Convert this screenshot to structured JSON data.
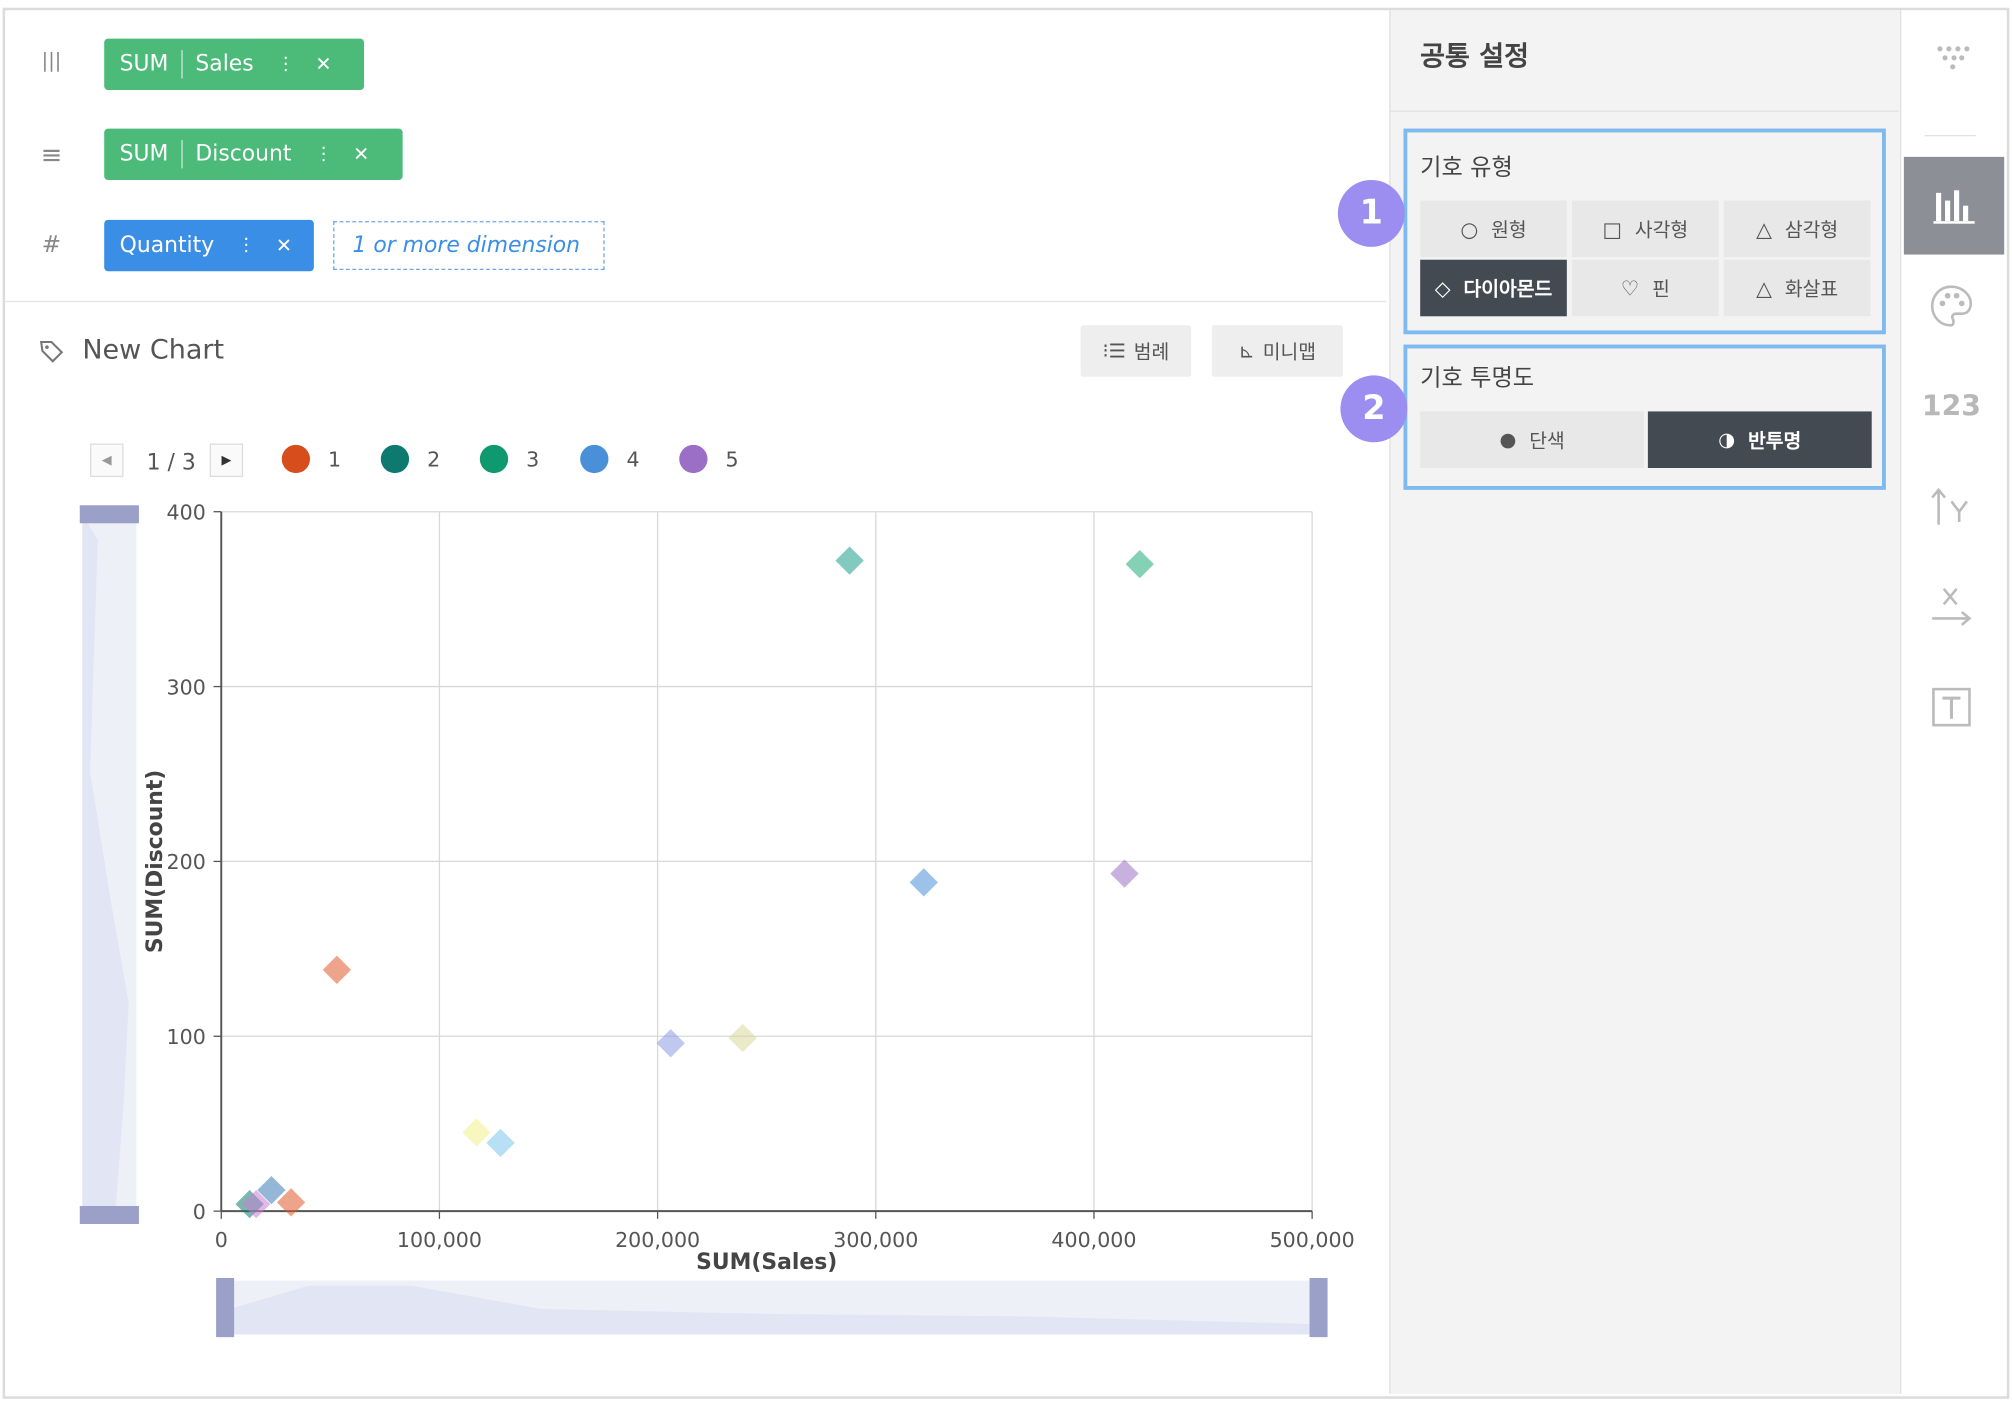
{
  "shelves": {
    "columns": {
      "agg": "SUM",
      "field": "Sales"
    },
    "rows": {
      "agg": "SUM",
      "field": "Discount"
    },
    "measure": {
      "field": "Quantity"
    },
    "placeholder": "1 or more dimension"
  },
  "chart_header": {
    "title": "New Chart",
    "legend_button": "범례",
    "minimap_button": "미니맵"
  },
  "legend": {
    "page": "1 / 3",
    "items": [
      {
        "label": "1",
        "color": "#d84d1c"
      },
      {
        "label": "2",
        "color": "#0e7a6f"
      },
      {
        "label": "3",
        "color": "#0e9a6e"
      },
      {
        "label": "4",
        "color": "#4a90d9"
      },
      {
        "label": "5",
        "color": "#9b6fc5"
      }
    ]
  },
  "chart_data": {
    "type": "scatter",
    "marker": "diamond",
    "xlabel": "SUM(Sales)",
    "ylabel": "SUM(Discount)",
    "xlim": [
      0,
      500000
    ],
    "ylim": [
      0,
      400
    ],
    "xticks": [
      "0",
      "100,000",
      "200,000",
      "300,000",
      "400,000",
      "500,000"
    ],
    "yticks": [
      "0",
      "100",
      "200",
      "300",
      "400"
    ],
    "grid": true,
    "points": [
      {
        "x": 288000,
        "y": 372,
        "color": "#1b9e8a"
      },
      {
        "x": 421000,
        "y": 370,
        "color": "#1fab7a"
      },
      {
        "x": 322000,
        "y": 188,
        "color": "#4a90d9"
      },
      {
        "x": 414000,
        "y": 193,
        "color": "#9b6fc5"
      },
      {
        "x": 53000,
        "y": 138,
        "color": "#e05a2a"
      },
      {
        "x": 206000,
        "y": 96,
        "color": "#8a9be0"
      },
      {
        "x": 239000,
        "y": 99,
        "color": "#d8d79a"
      },
      {
        "x": 117000,
        "y": 45,
        "color": "#f2f08a"
      },
      {
        "x": 128000,
        "y": 39,
        "color": "#7cc7ef"
      },
      {
        "x": 23000,
        "y": 12,
        "color": "#3d7bb8"
      },
      {
        "x": 13000,
        "y": 4,
        "color": "#0e7a6f"
      },
      {
        "x": 16000,
        "y": 4,
        "color": "#c97fd1"
      },
      {
        "x": 32000,
        "y": 5,
        "color": "#e05a2a"
      }
    ]
  },
  "panel": {
    "title": "공통 설정",
    "symbol_type": {
      "label": "기호 유형",
      "options": [
        {
          "label": "원형",
          "icon": "circle-outline-icon"
        },
        {
          "label": "사각형",
          "icon": "square-outline-icon"
        },
        {
          "label": "삼각형",
          "icon": "triangle-outline-icon"
        },
        {
          "label": "다이아몬드",
          "icon": "diamond-outline-icon",
          "selected": true
        },
        {
          "label": "핀",
          "icon": "pin-outline-icon"
        },
        {
          "label": "화살표",
          "icon": "arrow-outline-icon"
        }
      ]
    },
    "symbol_opacity": {
      "label": "기호 투명도",
      "options": [
        {
          "label": "단색",
          "icon": "drop-icon"
        },
        {
          "label": "반투명",
          "icon": "half-circle-icon",
          "selected": true
        }
      ]
    },
    "badges": [
      "1",
      "2"
    ]
  },
  "rail": {
    "items": [
      "chart-type-icon",
      "bar-chart-icon",
      "palette-icon",
      "number-format-icon",
      "y-axis-icon",
      "x-axis-icon",
      "text-icon"
    ],
    "number_label": "123"
  }
}
